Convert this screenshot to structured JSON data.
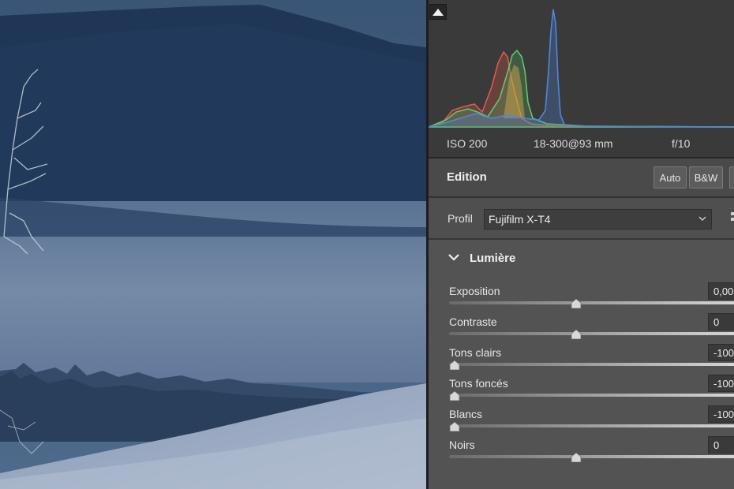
{
  "histogram": {
    "clip_warning_icon": "shadow-clipping-icon",
    "colors": {
      "red": "#e65a4a",
      "green": "#5fcf6a",
      "blue": "#4f86e0",
      "yellow": "#d4b44a"
    }
  },
  "exif": {
    "iso": "ISO 200",
    "lens": "18-300@93 mm",
    "aperture": "f/10"
  },
  "edition": {
    "title": "Edition",
    "auto_label": "Auto",
    "bw_label": "B&W"
  },
  "profile": {
    "label": "Profil",
    "value": "Fujifilm X-T4",
    "browse_icon": "grid-icon"
  },
  "section": {
    "title": "Lumière",
    "expanded": true
  },
  "sliders": [
    {
      "label": "Exposition",
      "value": "0,00",
      "level": 0.5
    },
    {
      "label": "Contraste",
      "value": "0",
      "level": 0.5
    },
    {
      "label": "Tons clairs",
      "value": "-100",
      "level": 0.0
    },
    {
      "label": "Tons foncés",
      "value": "-100",
      "level": 0.0
    },
    {
      "label": "Blancs",
      "value": "-100",
      "level": 0.0
    },
    {
      "label": "Noirs",
      "value": "0",
      "level": 0.5
    }
  ]
}
